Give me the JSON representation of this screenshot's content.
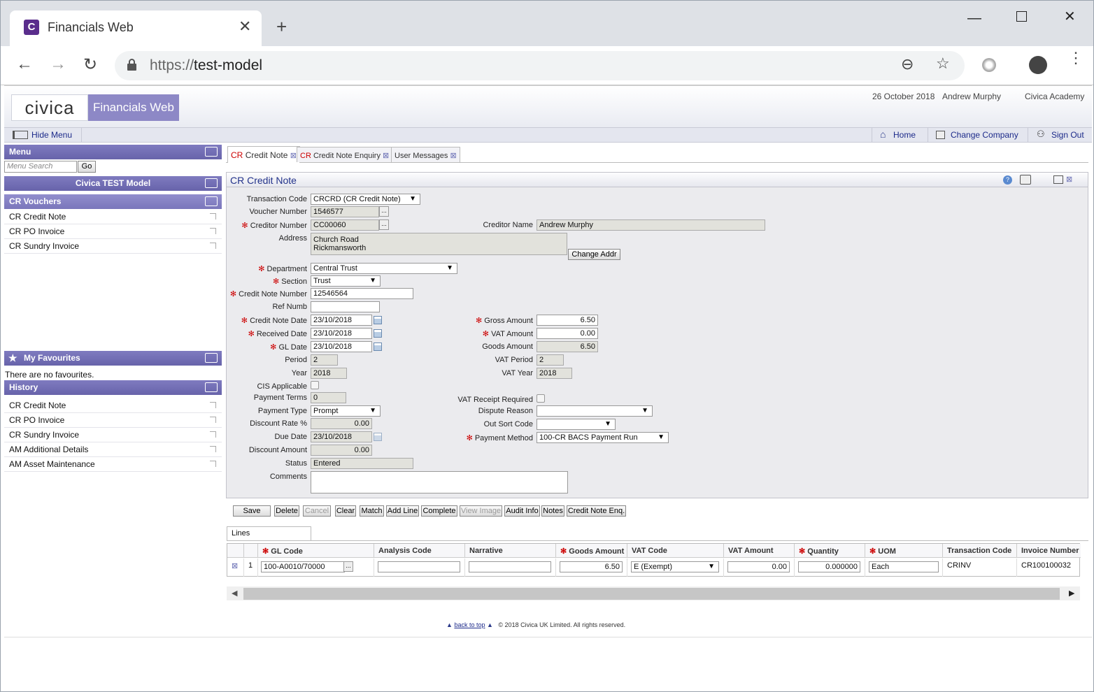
{
  "browser": {
    "tab_title": "Financials Web",
    "url_scheme": "https://",
    "url_host": "test-model",
    "favicon_letter": "C"
  },
  "app": {
    "logo_text": "civica",
    "app_name": "Financials Web",
    "date": "26 October 2018",
    "user": "Andrew Murphy",
    "company": "Civica Academy",
    "hide_menu": "Hide Menu",
    "nav": {
      "home": "Home",
      "change_company": "Change Company",
      "sign_out": "Sign Out"
    }
  },
  "menu": {
    "title": "Menu",
    "search_placeholder": "Menu Search",
    "go": "Go",
    "model": "Civica TEST Model",
    "vouchers_title": "CR Vouchers",
    "vouchers": [
      "CR Credit Note",
      "CR PO Invoice",
      "CR Sundry Invoice"
    ],
    "favourites_title": "My Favourites",
    "favourites_empty": "There are no favourites.",
    "history_title": "History",
    "history": [
      "CR Credit Note",
      "CR PO Invoice",
      "CR Sundry Invoice",
      "AM Additional Details",
      "AM Asset Maintenance"
    ]
  },
  "tabs": [
    {
      "prefix": "CR",
      "label": "Credit Note"
    },
    {
      "prefix": "CR",
      "label": "Credit Note Enquiry"
    },
    {
      "prefix": "",
      "label": "User Messages"
    }
  ],
  "form": {
    "title": "CR Credit Note",
    "labels": {
      "transaction_code": "Transaction Code",
      "voucher_number": "Voucher Number",
      "creditor_number": "Creditor Number",
      "creditor_name": "Creditor Name",
      "address": "Address",
      "department": "Department",
      "section": "Section",
      "credit_note_number": "Credit Note Number",
      "ref_numb": "Ref Numb",
      "credit_note_date": "Credit Note Date",
      "received_date": "Received Date",
      "gl_date": "GL Date",
      "period": "Period",
      "year": "Year",
      "cis_applicable": "CIS Applicable",
      "payment_terms": "Payment Terms",
      "payment_type": "Payment Type",
      "discount_rate": "Discount Rate %",
      "due_date": "Due Date",
      "discount_amount": "Discount Amount",
      "status": "Status",
      "comments": "Comments",
      "gross_amount": "Gross Amount",
      "vat_amount": "VAT Amount",
      "goods_amount": "Goods Amount",
      "vat_period": "VAT Period",
      "vat_year": "VAT Year",
      "vat_receipt_required": "VAT Receipt Required",
      "dispute_reason": "Dispute Reason",
      "out_sort_code": "Out Sort Code",
      "payment_method": "Payment Method"
    },
    "values": {
      "transaction_code": "CRCRD (CR Credit Note)",
      "voucher_number": "1546577",
      "creditor_number": "CC00060",
      "creditor_name": "Andrew Murphy",
      "address_line1": "Church Road",
      "address_line2": "Rickmansworth",
      "change_addr": "Change Addr",
      "department": "Central Trust",
      "section": "Trust",
      "credit_note_number": "12546564",
      "ref_numb": "",
      "credit_note_date": "23/10/2018",
      "received_date": "23/10/2018",
      "gl_date": "23/10/2018",
      "period": "2",
      "year": "2018",
      "payment_terms": "0",
      "payment_type": "Prompt",
      "discount_rate": "0.00",
      "due_date": "23/10/2018",
      "discount_amount": "0.00",
      "status": "Entered",
      "comments": "",
      "gross_amount": "6.50",
      "vat_amount": "0.00",
      "goods_amount": "6.50",
      "vat_period": "2",
      "vat_year": "2018",
      "dispute_reason": "",
      "out_sort_code": "",
      "payment_method": "100-CR BACS Payment Run"
    }
  },
  "buttons": [
    "Save",
    "Delete",
    "Cancel",
    "Clear",
    "Match",
    "Add Line",
    "Complete",
    "View Image",
    "Audit Info",
    "Notes",
    "Credit Note Enq."
  ],
  "lines": {
    "tab": "Lines",
    "columns": [
      "GL Code",
      "Analysis Code",
      "Narrative",
      "Goods Amount",
      "VAT Code",
      "VAT Amount",
      "Quantity",
      "UOM",
      "Transaction Code",
      "Invoice Number"
    ],
    "row": {
      "index": "1",
      "gl_code": "100-A0010/70000",
      "analysis_code": "",
      "narrative": "",
      "goods_amount": "6.50",
      "vat_code": "E (Exempt)",
      "vat_amount": "0.00",
      "quantity": "0.000000",
      "uom": "Each",
      "transaction_code": "CRINV",
      "invoice_number": "CR100100032"
    }
  },
  "footer": {
    "back_to_top": "back to top",
    "copyright": "© 2018 Civica UK Limited. All rights reserved."
  }
}
